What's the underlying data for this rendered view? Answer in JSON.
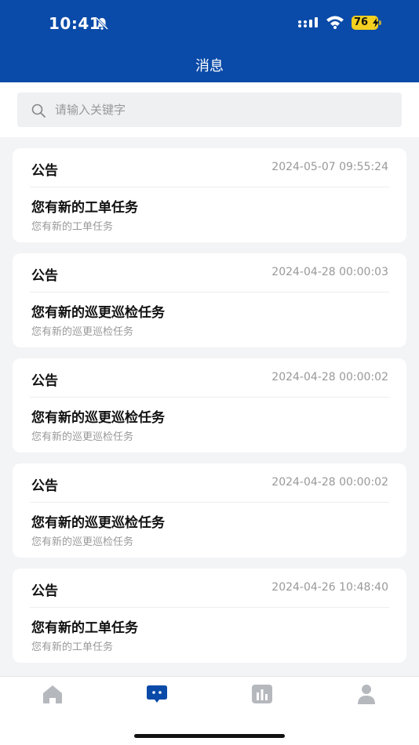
{
  "status_bar": {
    "time": "10:41",
    "battery": "76"
  },
  "header": {
    "title": "消息"
  },
  "search": {
    "placeholder": "请输入关键字"
  },
  "messages": [
    {
      "type": "公告",
      "time": "2024-05-07 09:55:24",
      "title": "您有新的工单任务",
      "subtitle": "您有新的工单任务"
    },
    {
      "type": "公告",
      "time": "2024-04-28 00:00:03",
      "title": "您有新的巡更巡检任务",
      "subtitle": "您有新的巡更巡检任务"
    },
    {
      "type": "公告",
      "time": "2024-04-28 00:00:02",
      "title": "您有新的巡更巡检任务",
      "subtitle": "您有新的巡更巡检任务"
    },
    {
      "type": "公告",
      "time": "2024-04-28 00:00:02",
      "title": "您有新的巡更巡检任务",
      "subtitle": "您有新的巡更巡检任务"
    },
    {
      "type": "公告",
      "time": "2024-04-26 10:48:40",
      "title": "您有新的工单任务",
      "subtitle": "您有新的工单任务"
    }
  ],
  "tabbar": {
    "tabs": [
      {
        "icon": "home-icon",
        "active": false
      },
      {
        "icon": "message-icon",
        "active": true
      },
      {
        "icon": "chart-icon",
        "active": false
      },
      {
        "icon": "user-icon",
        "active": false
      }
    ]
  },
  "colors": {
    "brand": "#0a4aa8",
    "tab_inactive": "#b5b8bd",
    "battery": "#f5d020"
  }
}
